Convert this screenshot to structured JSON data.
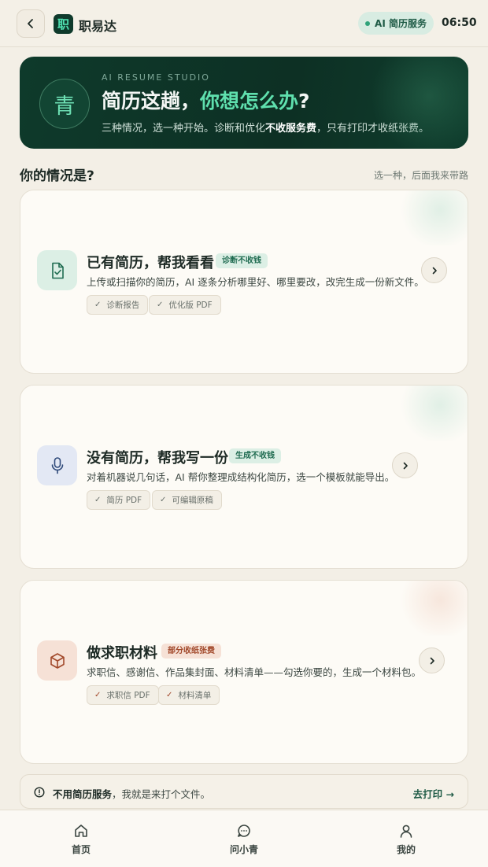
{
  "header": {
    "back_icon": "chevron-left-icon",
    "logo_glyph": "职",
    "app_name": "职易达",
    "ai_badge": "AI 简历服务",
    "clock": "06:50"
  },
  "hero": {
    "seal_glyph": "青",
    "eyebrow": "AI RESUME STUDIO",
    "title_main": "简历这趟，",
    "title_accent": "你想怎么办",
    "title_end": "?",
    "subtitle_pre": "三种情况，选一种开始。诊断和优化",
    "subtitle_bold": "不收服务费",
    "subtitle_post": "，只有打印才收纸张费。"
  },
  "section": {
    "title": "你的情况是?",
    "hint": "选一种，后面我来带路"
  },
  "cards": [
    {
      "icon": "document-check-icon",
      "title": "已有简历，帮我看看",
      "tag": "诊断不收钱",
      "desc": "上传或扫描你的简历，AI 逐条分析哪里好、哪里要改，改完生成一份新文件。",
      "chips": [
        "诊断报告",
        "优化版 PDF"
      ]
    },
    {
      "icon": "microphone-icon",
      "title": "没有简历，帮我写一份",
      "tag": "生成不收钱",
      "desc": "对着机器说几句话，AI 帮你整理成结构化简历，选一个模板就能导出。",
      "chips": [
        "简历 PDF",
        "可编辑原稿"
      ]
    },
    {
      "icon": "package-box-icon",
      "title": "做求职材料",
      "tag": "部分收纸张费",
      "desc": "求职信、感谢信、作品集封面、材料清单——勾选你要的，生成一个材料包。",
      "chips": [
        "求职信 PDF",
        "材料清单"
      ]
    }
  ],
  "print_bar": {
    "bold": "不用简历服务",
    "text": "，我就是来打个文件。",
    "link": "去打印 →"
  },
  "nav": [
    {
      "icon": "home-icon",
      "label": "首页"
    },
    {
      "icon": "chat-bubble-icon",
      "label": "问小青"
    },
    {
      "icon": "user-icon",
      "label": "我的"
    }
  ],
  "colors": {
    "brand_dark": "#0e3a2b",
    "brand_accent": "#5fe0ae",
    "warm_accent": "#a2492b",
    "background": "#f3efe6"
  }
}
